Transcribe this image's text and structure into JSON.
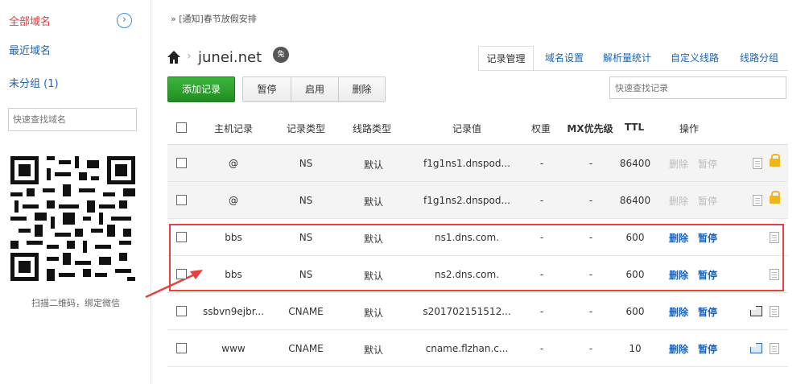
{
  "sidebar": {
    "items": [
      "全部域名",
      "最近域名",
      "未分组 (1)"
    ],
    "collapse_icon": "chevron-right-circle-icon",
    "search_placeholder": "快速查找域名",
    "qr_caption": "扫描二维码，绑定微信"
  },
  "notice": "» [通知]春节放假安排",
  "domain": "junei.net",
  "domain_badge": "兔",
  "tabs": [
    "记录管理",
    "域名设置",
    "解析量统计",
    "自定义线路",
    "线路分组"
  ],
  "toolbar": {
    "add_label": "添加记录",
    "pause_label": "暂停",
    "enable_label": "启用",
    "delete_label": "删除",
    "search_placeholder": "快速查找记录"
  },
  "table": {
    "headers": [
      "主机记录",
      "记录类型",
      "线路类型",
      "记录值",
      "权重",
      "MX优先级",
      "TTL",
      "操作"
    ],
    "rows": [
      {
        "host": "@",
        "type": "NS",
        "line": "默认",
        "value": "f1g1ns1.dnspod...",
        "weight": "-",
        "mx": "-",
        "ttl": "86400",
        "del": "删除",
        "pause": "暂停",
        "system": true
      },
      {
        "host": "@",
        "type": "NS",
        "line": "默认",
        "value": "f1g1ns2.dnspod...",
        "weight": "-",
        "mx": "-",
        "ttl": "86400",
        "del": "删除",
        "pause": "暂停",
        "system": true
      },
      {
        "host": "bbs",
        "type": "NS",
        "line": "默认",
        "value": "ns1.dns.com.",
        "weight": "-",
        "mx": "-",
        "ttl": "600",
        "del": "删除",
        "pause": "暂停",
        "system": false
      },
      {
        "host": "bbs",
        "type": "NS",
        "line": "默认",
        "value": "ns2.dns.com.",
        "weight": "-",
        "mx": "-",
        "ttl": "600",
        "del": "删除",
        "pause": "暂停",
        "system": false
      },
      {
        "host": "ssbvn9ejbr...",
        "type": "CNAME",
        "line": "默认",
        "value": "s201702151512...",
        "weight": "-",
        "mx": "-",
        "ttl": "600",
        "del": "删除",
        "pause": "暂停",
        "system": false
      },
      {
        "host": "www",
        "type": "CNAME",
        "line": "默认",
        "value": "cname.flzhan.c...",
        "weight": "-",
        "mx": "-",
        "ttl": "10",
        "del": "删除",
        "pause": "暂停",
        "system": false
      }
    ]
  },
  "colors": {
    "accent": "#1a63b8",
    "active": "#e13f3f",
    "add_button": "#2ca02c",
    "highlight": "#e8403c"
  }
}
